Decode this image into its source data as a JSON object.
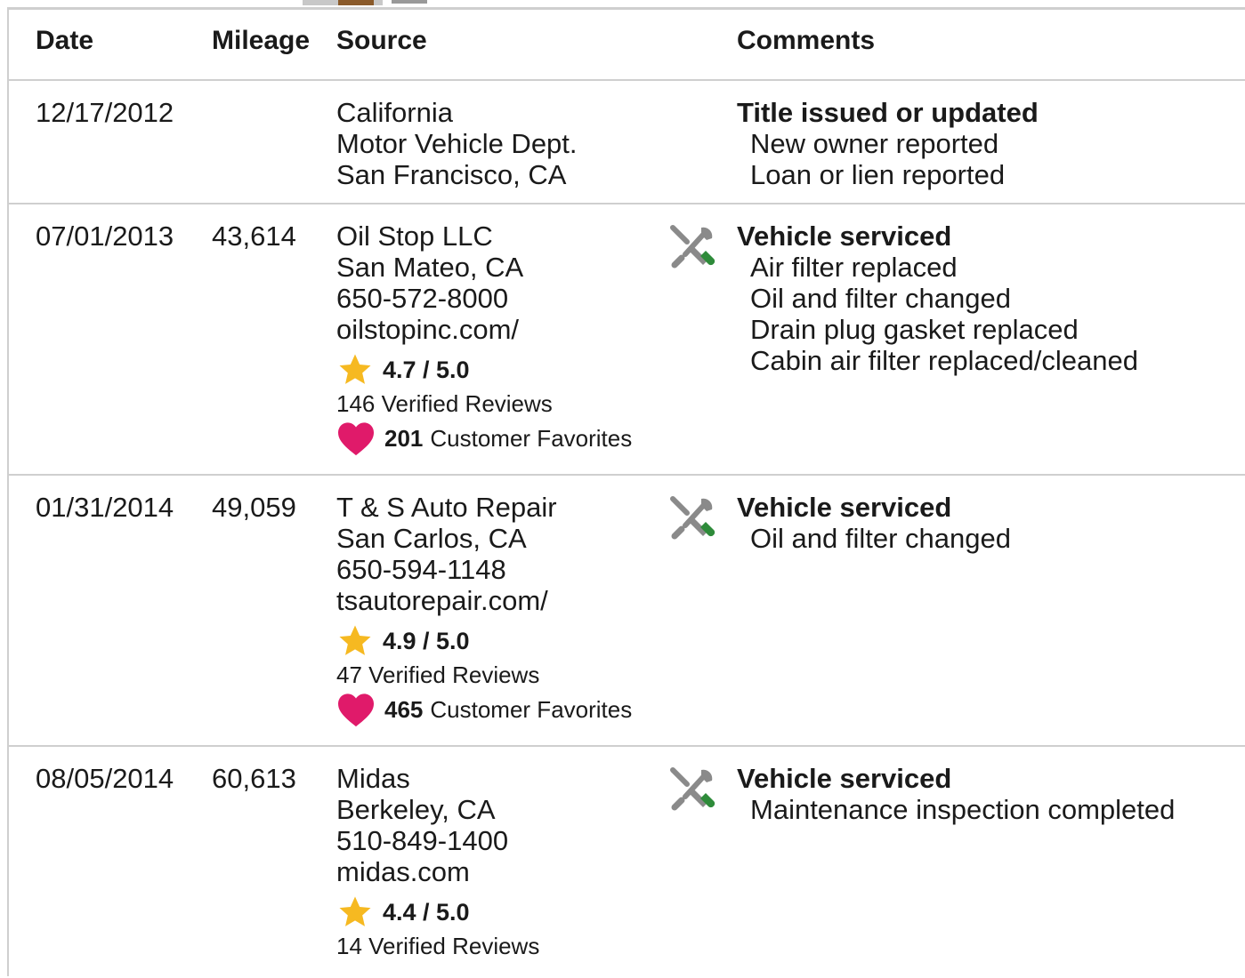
{
  "header": {
    "date": "Date",
    "mileage": "Mileage",
    "source": "Source",
    "comments": "Comments"
  },
  "colors": {
    "border": "#cfcfcf",
    "star": "#f6b921",
    "heart": "#e01a6a",
    "tool_gray": "#8a8a8a",
    "tool_green": "#2e8b3a"
  },
  "records": [
    {
      "date": "12/17/2012",
      "mileage": "",
      "source": [
        "California",
        "Motor Vehicle Dept.",
        "San Francisco, CA"
      ],
      "icon": "",
      "comment_title": "Title issued or updated",
      "comment_items": [
        "New owner reported",
        "Loan or lien reported"
      ]
    },
    {
      "date": "07/01/2013",
      "mileage": "43,614",
      "source": [
        "Oil Stop LLC",
        "San Mateo, CA",
        "650-572-8000",
        "oilstopinc.com/"
      ],
      "rating": "4.7 / 5.0",
      "reviews": "146 Verified Reviews",
      "favorites_count": "201",
      "favorites_label": "Customer Favorites",
      "icon": "service-tools-icon",
      "comment_title": "Vehicle serviced",
      "comment_items": [
        "Air filter replaced",
        "Oil and filter changed",
        "Drain plug gasket replaced",
        "Cabin air filter replaced/cleaned"
      ]
    },
    {
      "date": "01/31/2014",
      "mileage": "49,059",
      "source": [
        "T & S Auto Repair",
        "San Carlos, CA",
        "650-594-1148",
        "tsautorepair.com/"
      ],
      "rating": "4.9 / 5.0",
      "reviews": "47 Verified Reviews",
      "favorites_count": "465",
      "favorites_label": "Customer Favorites",
      "icon": "service-tools-icon",
      "comment_title": "Vehicle serviced",
      "comment_items": [
        "Oil and filter changed"
      ]
    },
    {
      "date": "08/05/2014",
      "mileage": "60,613",
      "source": [
        "Midas",
        "Berkeley, CA",
        "510-849-1400",
        "midas.com"
      ],
      "rating": "4.4 / 5.0",
      "reviews": "14 Verified Reviews",
      "icon": "service-tools-icon",
      "comment_title": "Vehicle serviced",
      "comment_items": [
        "Maintenance inspection completed"
      ]
    }
  ]
}
